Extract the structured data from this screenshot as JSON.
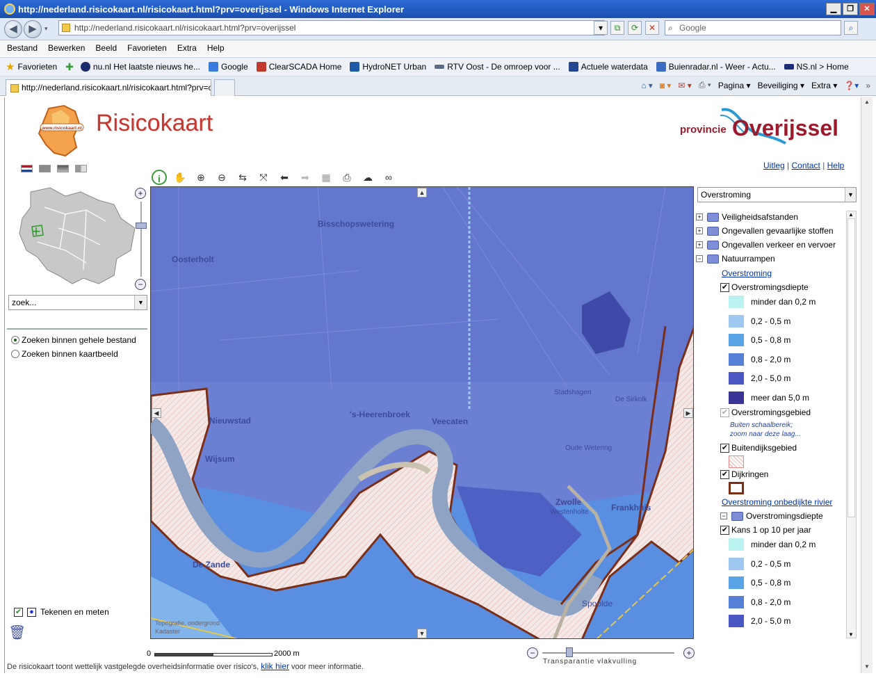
{
  "browser": {
    "title": "http://nederland.risicokaart.nl/risicokaart.html?prv=overijssel - Windows Internet Explorer",
    "address": "http://nederland.risicokaart.nl/risicokaart.html?prv=overijssel",
    "search_placeholder": "Google",
    "menu": [
      "Bestand",
      "Bewerken",
      "Beeld",
      "Favorieten",
      "Extra",
      "Help"
    ],
    "favorites_label": "Favorieten",
    "favorites": [
      {
        "label": "nu.nl  Het laatste nieuws he...",
        "color": "#1b2a6b"
      },
      {
        "label": "Google",
        "color": "#3a7be0"
      },
      {
        "label": "ClearSCADA Home",
        "color": "#c0392b"
      },
      {
        "label": "HydroNET Urban",
        "color": "#1e5aa8"
      },
      {
        "label": "RTV Oost - De omroep voor ...",
        "color": "#5a6b8a"
      },
      {
        "label": "Actuele waterdata",
        "color": "#24488f"
      },
      {
        "label": "Buienradar.nl - Weer - Actu...",
        "color": "#3b6ec2"
      },
      {
        "label": "NS.nl > Home",
        "color": "#1c2d78"
      }
    ],
    "tab_title": "http://nederland.risicokaart.nl/risicokaart.html?prv=o...",
    "commands": [
      "Pagina",
      "Beveiliging",
      "Extra"
    ]
  },
  "header": {
    "title": "Risicokaart",
    "logo_text": "www.risicokaart.nl",
    "province_small": "provincie",
    "province_big": "Overijssel",
    "links": [
      "Uitleg",
      "Contact",
      "Help"
    ]
  },
  "search": {
    "zoek_placeholder": "zoek...",
    "option_all": "Zoeken binnen gehele bestand",
    "option_view": "Zoeken binnen kaartbeeld"
  },
  "draw": {
    "label": "Tekenen en meten"
  },
  "map": {
    "places": [
      "Bisschopswetering",
      "Oosterholt",
      "Nieuwstad",
      "'s-Heerenbroek",
      "Veecaten",
      "Wijsum",
      "De Zande",
      "Zwolle",
      "Frankhuis",
      "Stadshagen",
      "Westenholte",
      "De Sirkolk",
      "Oude Wetering",
      "Spoolde",
      "Kadaster"
    ],
    "credits": "Topografie, ondergrond",
    "scale_start": "0",
    "scale_end": "2000 m",
    "transparency_label": "Transparantie vlakvulling",
    "transparency_level": 0.18
  },
  "footer": {
    "text_before": "De risicokaart toont wettelijk vastgelegde overheidsinformatie over risico's,",
    "link": "klik hier",
    "text_after": "voor meer informatie."
  },
  "layers": {
    "selected": "Overstroming",
    "groups": [
      "Veiligheidsafstanden",
      "Ongevallen gevaarlijke stoffen",
      "Ongevallen verkeer en vervoer",
      "Natuurrampen"
    ],
    "flood_link": "Overstroming",
    "depth_label": "Overstromingsdiepte",
    "legend": [
      {
        "label": "minder dan 0,2 m",
        "color": "#b9f2ee"
      },
      {
        "label": "0,2 - 0,5 m",
        "color": "#9fc8f0"
      },
      {
        "label": "0,5 - 0,8 m",
        "color": "#5aa4e6"
      },
      {
        "label": "0,8 - 2,0 m",
        "color": "#5680d6"
      },
      {
        "label": "2,0 - 5,0 m",
        "color": "#4b58c4"
      },
      {
        "label": "meer dan 5,0 m",
        "color": "#3a3496"
      }
    ],
    "area_label": "Overstromingsgebied",
    "area_hint1": "Buiten schaalbereik;",
    "area_hint2": "zoom naar deze laag...",
    "outer_label": "Buitendijksgebied",
    "dike_label": "Dijkringen",
    "unprotected_link": "Overstroming onbedijkte rivier",
    "sub_depth_label": "Overstromingsdiepte",
    "chance_label": "Kans 1 op 10 per jaar",
    "legend2": [
      {
        "label": "minder dan 0,2 m",
        "color": "#b9f2ee"
      },
      {
        "label": "0,2 - 0,5 m",
        "color": "#9fc8f0"
      },
      {
        "label": "0,5 - 0,8 m",
        "color": "#5aa4e6"
      },
      {
        "label": "0,8 - 2,0 m",
        "color": "#5680d6"
      },
      {
        "label": "2,0 - 5,0 m",
        "color": "#4b58c4"
      }
    ]
  },
  "colors": {
    "brand_red": "#c6372f",
    "province_red": "#9b1b2d",
    "map_blue": "#6b7fd3",
    "river": "#8fa4c4",
    "dike": "#7a2e18"
  }
}
